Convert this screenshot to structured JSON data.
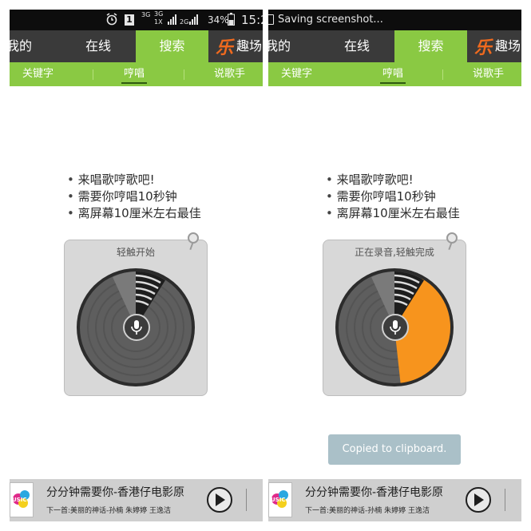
{
  "panels": {
    "left": {
      "status_bar": {
        "network_3g_a": "3G",
        "network_3g_b": "3G",
        "network_1x": "1X",
        "network_2g": "2G",
        "notification_count": "1",
        "battery": "34%",
        "time": "15:2"
      },
      "tabs": {
        "mine": "我的",
        "online": "在线",
        "search": "搜索",
        "fun": "趣场"
      },
      "subtabs": {
        "keyword": "关键字",
        "hum": "哼唱",
        "sing": "说歌手"
      },
      "instructions": [
        "来唱歌哼歌吧!",
        "需要你哼唱10秒钟",
        "离屏幕10厘米左右最佳"
      ],
      "recorder_hint": "轻触开始",
      "recording_progress": 0,
      "player": {
        "song_title": "分分钟需要你-香港仔电影原",
        "next_song": "下一首:美丽的神话-孙楠 朱婷婷 王逸洁",
        "album_label": "USIC"
      }
    },
    "right": {
      "status_bar": {
        "notification_text": "Saving screenshot..."
      },
      "tabs": {
        "mine": "我的",
        "online": "在线",
        "search": "搜索",
        "fun": "趣场"
      },
      "subtabs": {
        "keyword": "关键字",
        "hum": "哼唱",
        "sing": "说歌手"
      },
      "instructions": [
        "来唱歌哼歌吧!",
        "需要你哼唱10秒钟",
        "离屏幕10厘米左右最佳"
      ],
      "recorder_hint": "正在录音,轻触完成",
      "recording_progress": 0.4,
      "toast": "Copied to clipboard.",
      "player": {
        "song_title": "分分钟需要你-香港仔电影原",
        "next_song": "下一首:美丽的神话-孙楠 朱婷婷 王逸洁",
        "album_label": "USIC"
      }
    }
  },
  "colors": {
    "accent_green": "#8ac943",
    "progress_orange": "#f7941d",
    "tab_bar": "#3a3a3a",
    "status_bar": "#0d0d0d",
    "logo": "#f06a1e"
  }
}
